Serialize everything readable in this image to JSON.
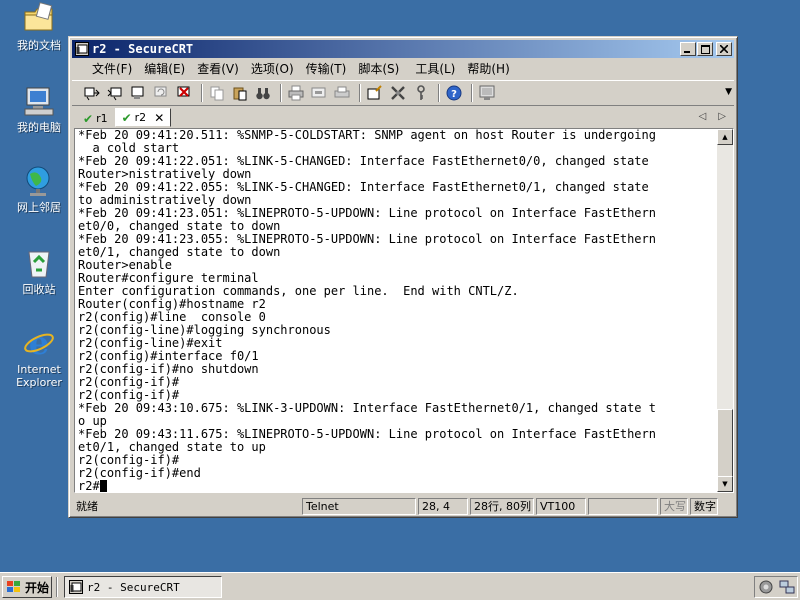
{
  "desktop": {
    "icons": [
      {
        "label": "我的文档"
      },
      {
        "label": "我的电脑"
      },
      {
        "label": "网上邻居"
      },
      {
        "label": "回收站"
      },
      {
        "label_line1": "Internet",
        "label_line2": "Explorer"
      }
    ]
  },
  "window": {
    "title": "r2 - SecureCRT",
    "menu": [
      "文件(F)",
      "编辑(E)",
      "查看(V)",
      "选项(O)",
      "传输(T)",
      "脚本(S)",
      "工具(L)",
      "帮助(H)"
    ],
    "tabs": [
      {
        "label": "r1"
      },
      {
        "label": "r2",
        "close": "✕"
      }
    ]
  },
  "terminal": {
    "lines": [
      "*Feb 20 09:41:20.511: %SNMP-5-COLDSTART: SNMP agent on host Router is undergoing",
      "  a cold start",
      "*Feb 20 09:41:22.051: %LINK-5-CHANGED: Interface FastEthernet0/0, changed state",
      "Router>nistratively down",
      "*Feb 20 09:41:22.055: %LINK-5-CHANGED: Interface FastEthernet0/1, changed state",
      "to administratively down",
      "*Feb 20 09:41:23.051: %LINEPROTO-5-UPDOWN: Line protocol on Interface FastEthern",
      "et0/0, changed state to down",
      "*Feb 20 09:41:23.055: %LINEPROTO-5-UPDOWN: Line protocol on Interface FastEthern",
      "et0/1, changed state to down",
      "Router>enable",
      "Router#configure terminal",
      "Enter configuration commands, one per line.  End with CNTL/Z.",
      "Router(config)#hostname r2",
      "r2(config)#line  console 0",
      "r2(config-line)#logging synchronous",
      "r2(config-line)#exit",
      "r2(config)#interface f0/1",
      "r2(config-if)#no shutdown",
      "r2(config-if)#",
      "r2(config-if)#",
      "*Feb 20 09:43:10.675: %LINK-3-UPDOWN: Interface FastEthernet0/1, changed state t",
      "o up",
      "*Feb 20 09:43:11.675: %LINEPROTO-5-UPDOWN: Line protocol on Interface FastEthern",
      "et0/1, changed state to up",
      "r2(config-if)#",
      "r2(config-if)#end"
    ],
    "prompt": "r2#"
  },
  "status": {
    "ready": "就绪",
    "protocol": "Telnet",
    "cursor_pos": "28,  4",
    "size": "28行, 80列",
    "emulation": "VT100",
    "caps": "大写",
    "num": "数字"
  },
  "taskbar": {
    "start": "开始",
    "task": "r2 - SecureCRT"
  },
  "colors": {
    "desktop": "#3a6ea5",
    "title_start": "#0a246a",
    "title_end": "#a6caf0",
    "chrome": "#d4d0c8"
  }
}
